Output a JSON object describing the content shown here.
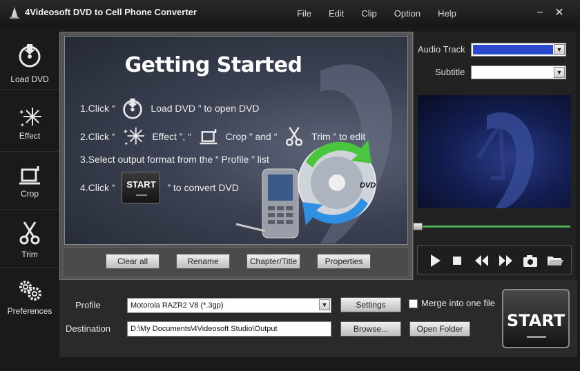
{
  "window": {
    "title": "4Videosoft DVD to Cell Phone Converter",
    "minimize_glyph": "−",
    "close_glyph": "✕"
  },
  "menu": [
    "File",
    "Edit",
    "Clip",
    "Option",
    "Help"
  ],
  "sidebar": [
    {
      "label": "Load DVD",
      "icon": "load-dvd-icon"
    },
    {
      "label": "Effect",
      "icon": "effect-icon"
    },
    {
      "label": "Crop",
      "icon": "crop-icon"
    },
    {
      "label": "Trim",
      "icon": "scissors-icon"
    },
    {
      "label": "Preferences",
      "icon": "gears-icon"
    }
  ],
  "getting_started": {
    "title": "Getting Started",
    "step1": {
      "pre": "1.Click “",
      "after": "Load DVD ” to open DVD"
    },
    "step2": {
      "pre": "2.Click “",
      "effect": "Effect ”, “",
      "crop": "Crop ” and “",
      "trim": "Trim ” to edit"
    },
    "step3": "3.Select output format from the “ Profile ” list",
    "step4": {
      "pre": "4.Click “",
      "button": "START",
      "after": "” to convert DVD"
    },
    "dvd_badge": "DVD"
  },
  "buttons": {
    "clear_all": "Clear all",
    "rename": "Rename",
    "chapter_title": "Chapter/Title",
    "properties": "Properties",
    "settings": "Settings",
    "browse": "Browse...",
    "open_folder": "Open Folder",
    "start": "START"
  },
  "right_panel": {
    "audio_track_label": "Audio Track",
    "audio_track_value": "",
    "subtitle_label": "Subtitle",
    "subtitle_value": ""
  },
  "output": {
    "profile_label": "Profile",
    "profile_value": "Motorola RAZR2 V8 (*.3gp)",
    "destination_label": "Destination",
    "destination_value": "D:\\My Documents\\4Videosoft Studio\\Output",
    "merge_label": "Merge into one file",
    "merge_checked": false
  },
  "colors": {
    "accent_blue": "#2c4ad0",
    "seek_green": "#4fb04f",
    "arrow_green": "#49c63d",
    "arrow_blue": "#2f8fe0"
  }
}
